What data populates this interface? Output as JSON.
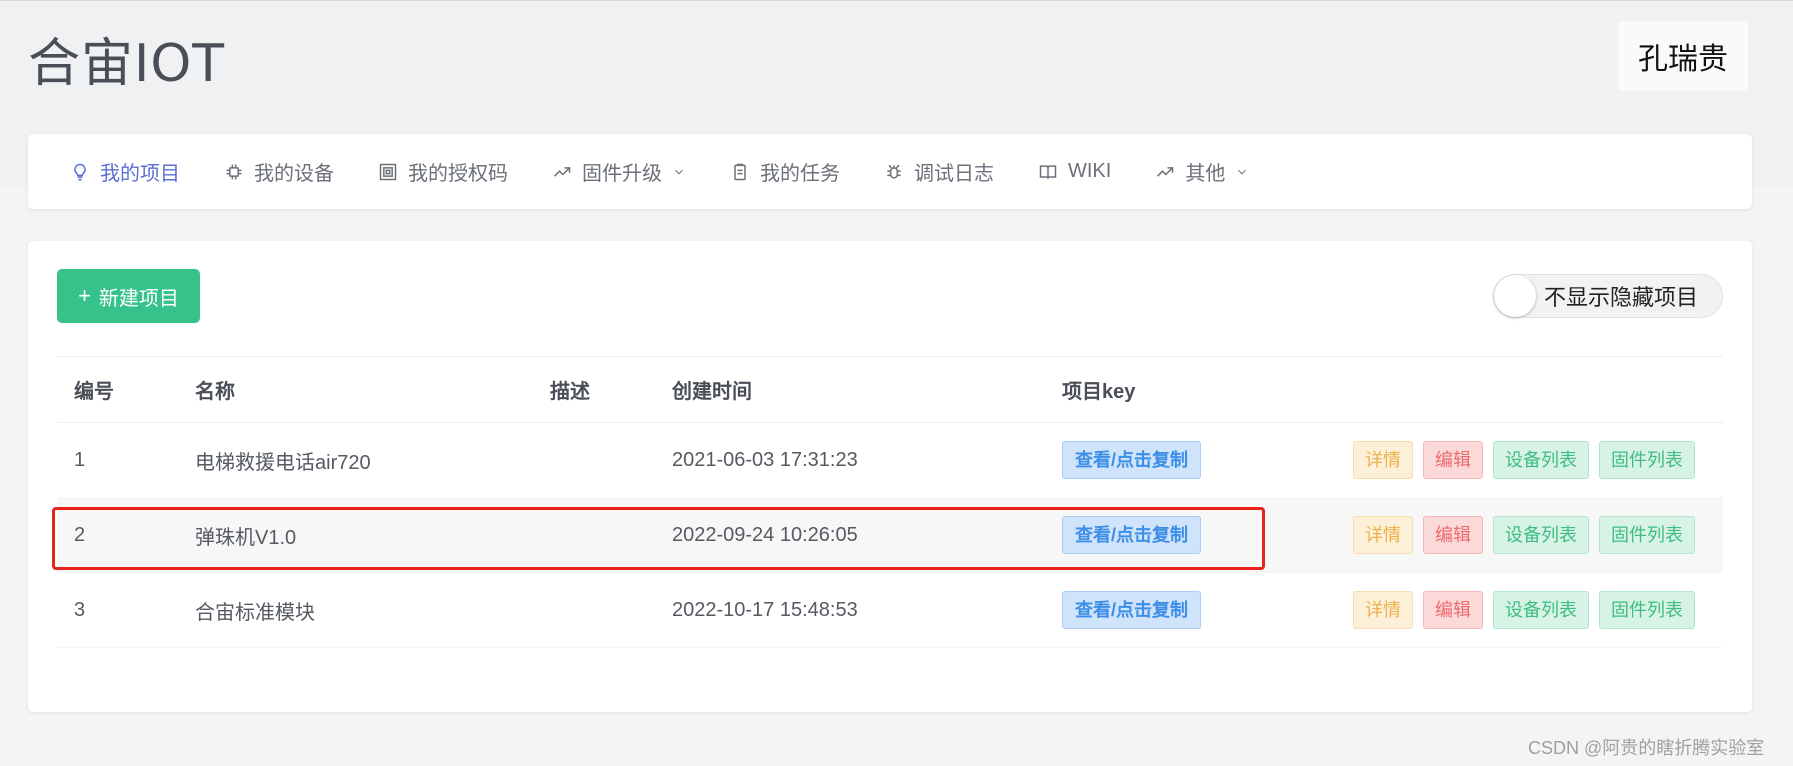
{
  "app": {
    "title": "合宙IOT",
    "user": "孔瑞贵"
  },
  "nav": [
    {
      "label": "我的项目",
      "icon": "bulb-icon",
      "active": true,
      "dropdown": false
    },
    {
      "label": "我的设备",
      "icon": "chip-icon",
      "active": false,
      "dropdown": false
    },
    {
      "label": "我的授权码",
      "icon": "qrcode-icon",
      "active": false,
      "dropdown": false
    },
    {
      "label": "固件升级",
      "icon": "trend-icon",
      "active": false,
      "dropdown": true
    },
    {
      "label": "我的任务",
      "icon": "clipboard-icon",
      "active": false,
      "dropdown": false
    },
    {
      "label": "调试日志",
      "icon": "bug-icon",
      "active": false,
      "dropdown": false
    },
    {
      "label": "WIKI",
      "icon": "book-icon",
      "active": false,
      "dropdown": false
    },
    {
      "label": "其他",
      "icon": "trend-icon",
      "active": false,
      "dropdown": true
    }
  ],
  "toolbar": {
    "new_project": "新建项目",
    "toggle_label": "不显示隐藏项目",
    "toggle_on": false
  },
  "table": {
    "headers": [
      "编号",
      "名称",
      "描述",
      "创建时间",
      "项目key"
    ],
    "rows": [
      {
        "id": "1",
        "name": "电梯救援电话air720",
        "desc": "",
        "created": "2021-06-03 17:31:23",
        "key_button": "查看/点击复制"
      },
      {
        "id": "2",
        "name": "弹珠机V1.0",
        "desc": "",
        "created": "2022-09-24 10:26:05",
        "key_button": "查看/点击复制"
      },
      {
        "id": "3",
        "name": "合宙标准模块",
        "desc": "",
        "created": "2022-10-17 15:48:53",
        "key_button": "查看/点击复制"
      }
    ],
    "actions": {
      "detail": "详情",
      "edit": "编辑",
      "devices": "设备列表",
      "firmware": "固件列表"
    }
  },
  "watermark": "CSDN @阿贵的瞎折腾实验室",
  "colors": {
    "accent": "#5a6fd6",
    "primary_green": "#36c28a",
    "highlight": "#e8231b"
  }
}
